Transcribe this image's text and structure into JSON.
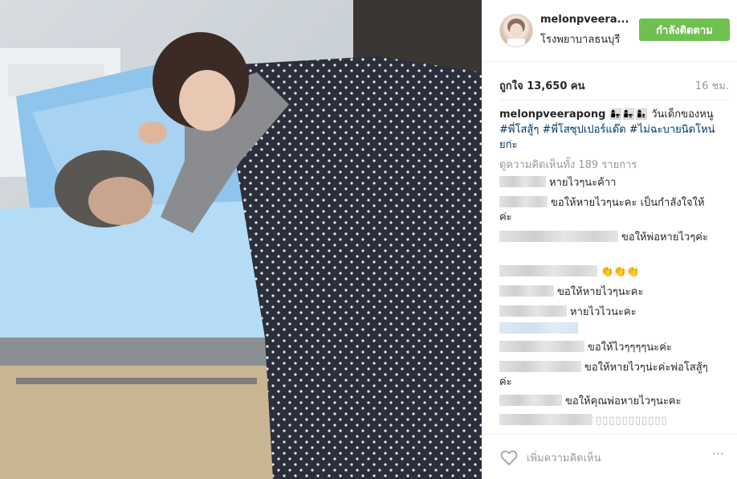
{
  "post": {
    "username": "melonpveera...",
    "location": "โรงพยาบาลธนบุรี",
    "follow_label": "กำลังติดตาม",
    "likes": "ถูกใจ 13,650 คน",
    "time": "16 ชม.",
    "caption_user": "melonpveerapong",
    "caption_text": "👩‍👧👩‍👧👩‍👦 วันเด็กของหนู",
    "caption_tags": "#พี่โสสู้ๆ #พี่โสซุปเปอร์แด๊ด #ไม่ฉะบายนิดโหน่ยก่ะ",
    "view_all": "ดูความคิดเห็นทั้ง 189 รายการ",
    "add_comment_placeholder": "เพิ่มความคิดเห็น",
    "more_icon": "···"
  },
  "comments": [
    {
      "text": "หายไวๆนะค้าา"
    },
    {
      "text": "ขอให้หายไวๆนะคะ เป็นกำลังใจให้ค่ะ"
    },
    {
      "text": "ขอให้พ่อหายไวๆค่ะ"
    },
    {
      "text": "👏👏👏"
    },
    {
      "text": "ขอให้หายไวๆนะคะ"
    },
    {
      "text": "หายไวไวนะคะ"
    },
    {
      "text": ""
    },
    {
      "text": "ขอให้ไวๆๆๆๆนะค่ะ"
    },
    {
      "text": "ขอให้หายไวๆน่ะค่ะพ่อโสสู้ๆค่ะ"
    },
    {
      "text": "ขอให้คุณพ่อหายไวๆนะคะ"
    },
    {
      "text": "▯▯▯▯▯▯▯▯▯▯▯"
    }
  ],
  "colors": {
    "follow_bg": "#70c050",
    "tag_link": "#003569",
    "muted": "#999999"
  },
  "icons": {
    "like": "heart-outline-icon",
    "more": "ellipsis-icon"
  }
}
